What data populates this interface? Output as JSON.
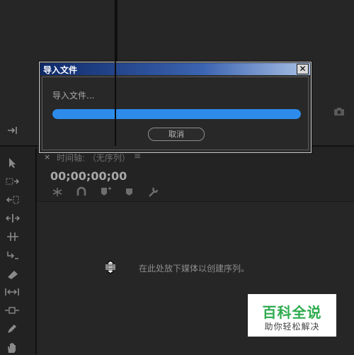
{
  "dialog": {
    "title": "导入文件",
    "close_glyph": "✕",
    "message": "导入文件...",
    "progress_percent": 100,
    "progress_color": "#2d8ceb",
    "cancel_label": "取消"
  },
  "timeline": {
    "close_glyph": "×",
    "title": "时间轴: （无序列）",
    "menu_glyph": "≡",
    "timecode": "00;00;00;00",
    "empty_message": "在此处放下媒体以创建序列。",
    "toolbar_icons": [
      "snap-icon",
      "linked-selection-icon",
      "add-marker-icon",
      "marker-icon",
      "wrench-icon"
    ]
  },
  "tools": {
    "icons": [
      "selection-tool-icon",
      "track-select-icon",
      "ripple-edit-icon",
      "rolling-edit-icon",
      "rate-stretch-icon",
      "razor-icon",
      "slip-icon",
      "slide-icon",
      "pen-icon",
      "hand-icon"
    ]
  },
  "watermark": {
    "title": "百科全说",
    "subtitle": "助你轻松解决",
    "title_color": "#2eab4e"
  },
  "colors": {
    "accent": "#2d8ceb",
    "panel_bg": "#232323"
  }
}
